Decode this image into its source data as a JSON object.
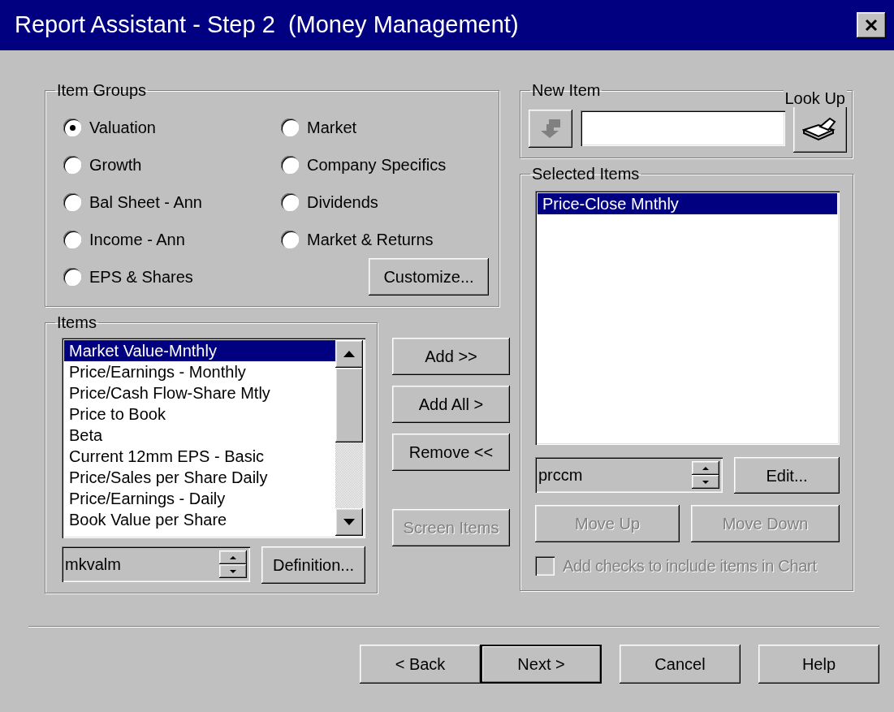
{
  "window": {
    "title": "Report Assistant - Step 2  (Money Management)"
  },
  "item_groups": {
    "title": "Item Groups",
    "options": [
      {
        "label": "Valuation",
        "selected": true
      },
      {
        "label": "Growth",
        "selected": false
      },
      {
        "label": "Bal Sheet - Ann",
        "selected": false
      },
      {
        "label": "Income - Ann",
        "selected": false
      },
      {
        "label": "EPS & Shares",
        "selected": false
      },
      {
        "label": "Market",
        "selected": false
      },
      {
        "label": "Company Specifics",
        "selected": false
      },
      {
        "label": "Dividends",
        "selected": false
      },
      {
        "label": "Market & Returns",
        "selected": false
      }
    ],
    "customize": "Customize..."
  },
  "items": {
    "title": "Items",
    "list": [
      {
        "label": "Market Value-Mnthly",
        "selected": true
      },
      {
        "label": "Price/Earnings - Monthly",
        "selected": false
      },
      {
        "label": "Price/Cash Flow-Share Mtly",
        "selected": false
      },
      {
        "label": "Price to Book",
        "selected": false
      },
      {
        "label": "Beta",
        "selected": false
      },
      {
        "label": "Current 12mm EPS - Basic",
        "selected": false
      },
      {
        "label": "Price/Sales per Share Daily",
        "selected": false
      },
      {
        "label": "Price/Earnings - Daily",
        "selected": false
      },
      {
        "label": "Book Value per Share",
        "selected": false
      }
    ],
    "code": "mkvalm",
    "definition": "Definition..."
  },
  "transfer_buttons": [
    {
      "label": "Add >>",
      "disabled": false
    },
    {
      "label": "Add All >",
      "disabled": false
    },
    {
      "label": "Remove <<",
      "disabled": false
    },
    {
      "label": "Screen Items",
      "disabled": true
    }
  ],
  "new_item": {
    "title": "New Item",
    "lookup_title": "Look Up"
  },
  "selected_items": {
    "title": "Selected Items",
    "list": [
      {
        "label": "Price-Close Mnthly",
        "selected": true
      }
    ],
    "code": "prccm",
    "edit": "Edit...",
    "move_buttons": [
      {
        "label": "Move Up",
        "disabled": true
      },
      {
        "label": "Move Down",
        "disabled": true
      }
    ],
    "chart_checkbox": {
      "label": "Add checks to include items in Chart",
      "checked": false,
      "disabled": true
    }
  },
  "footer_buttons": [
    {
      "label": "< Back",
      "default": false
    },
    {
      "label": "Next >",
      "default": true
    },
    {
      "label": "Cancel",
      "default": false
    },
    {
      "label": "Help",
      "default": false
    }
  ]
}
